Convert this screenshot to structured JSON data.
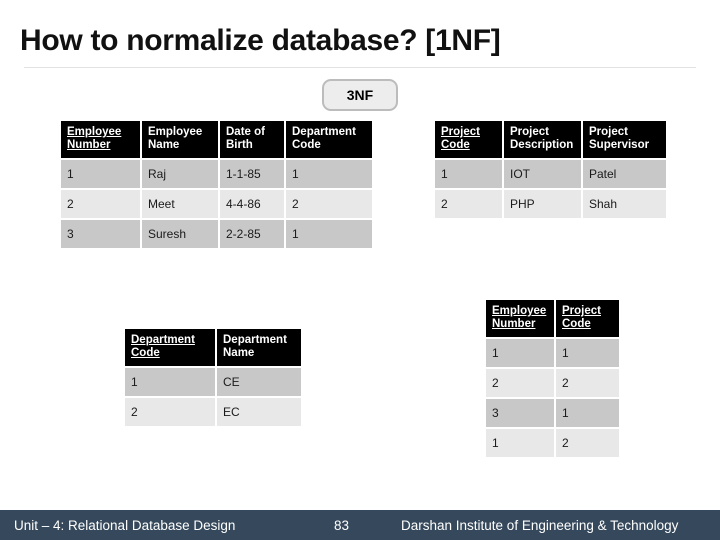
{
  "slide": {
    "title": "How to normalize database? [1NF]",
    "badge_label": "3NF"
  },
  "colors": {
    "footer_background": "#36495c",
    "header_background": "#000000",
    "row_dark": "#c8c8c8",
    "row_light": "#e8e8e8",
    "badge_background": "#ededed",
    "badge_border": "#bcbcbc"
  },
  "tables": {
    "employee": {
      "name": "Employee",
      "columns": [
        {
          "label_line1": "Employee",
          "label_line2": "Number",
          "primary_key": true
        },
        {
          "label_line1": "Employee",
          "label_line2": "Name",
          "primary_key": false
        },
        {
          "label_line1": "Date of",
          "label_line2": "Birth",
          "primary_key": false
        },
        {
          "label_line1": "Department",
          "label_line2": "Code",
          "primary_key": false
        }
      ],
      "rows": [
        [
          "1",
          "Raj",
          "1-1-85",
          "1"
        ],
        [
          "2",
          "Meet",
          "4-4-86",
          "2"
        ],
        [
          "3",
          "Suresh",
          "2-2-85",
          "1"
        ]
      ]
    },
    "project": {
      "name": "Project",
      "columns": [
        {
          "label_line1": "Project",
          "label_line2": "Code",
          "primary_key": true
        },
        {
          "label_line1": "Project",
          "label_line2": "Description",
          "primary_key": false
        },
        {
          "label_line1": "Project",
          "label_line2": "Supervisor",
          "primary_key": false
        }
      ],
      "rows": [
        [
          "1",
          "IOT",
          "Patel"
        ],
        [
          "2",
          "PHP",
          "Shah"
        ]
      ]
    },
    "department": {
      "name": "Department",
      "columns": [
        {
          "label_line1": "Department",
          "label_line2": "Code",
          "primary_key": true
        },
        {
          "label_line1": "Department",
          "label_line2": "Name",
          "primary_key": false
        }
      ],
      "rows": [
        [
          "1",
          "CE"
        ],
        [
          "2",
          "EC"
        ]
      ]
    },
    "employee_project": {
      "name": "Employee Project",
      "columns": [
        {
          "label_line1": "Employee",
          "label_line2": "Number",
          "primary_key": true
        },
        {
          "label_line1": "Project",
          "label_line2": "Code",
          "primary_key": true
        }
      ],
      "rows": [
        [
          "1",
          "1"
        ],
        [
          "2",
          "2"
        ],
        [
          "3",
          "1"
        ],
        [
          "1",
          "2"
        ]
      ]
    }
  },
  "footer": {
    "unit": "Unit – 4: Relational Database Design",
    "page_number": "83",
    "institute": "Darshan Institute of Engineering & Technology"
  }
}
